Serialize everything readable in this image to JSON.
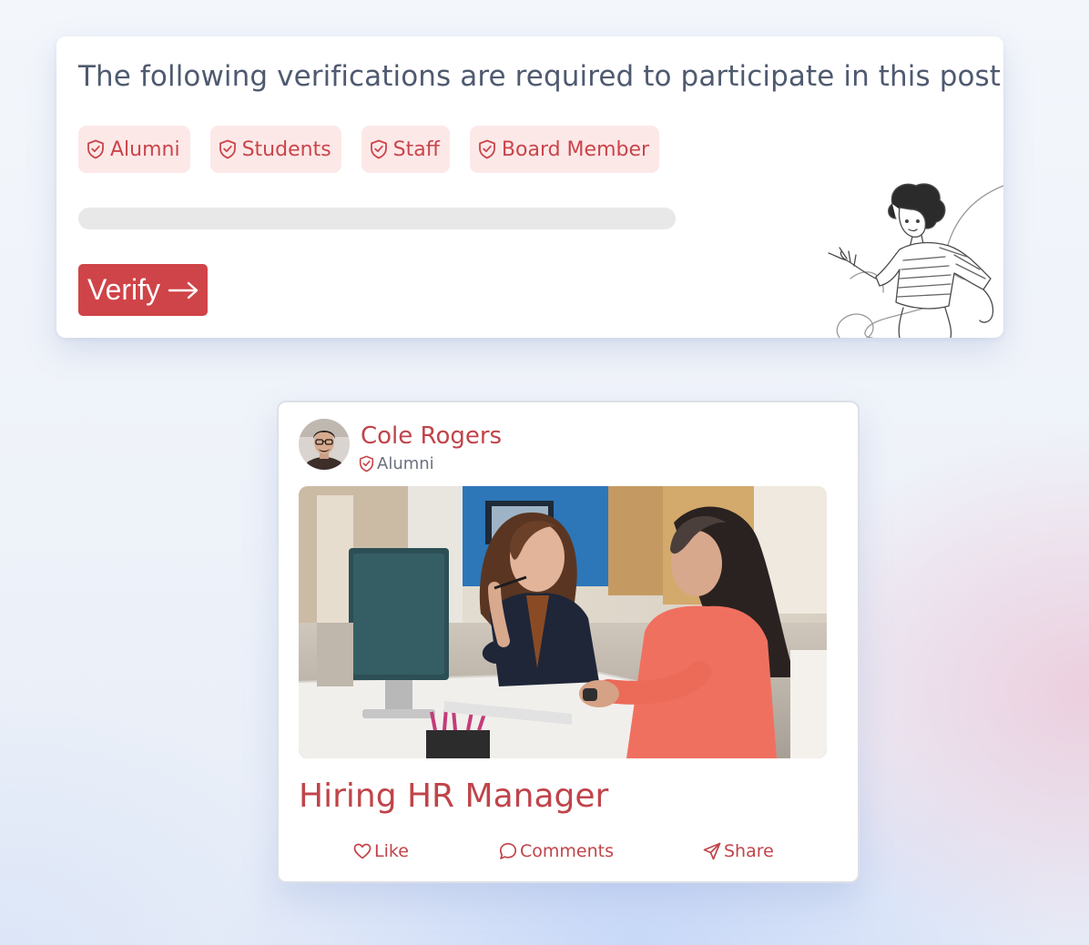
{
  "verification": {
    "title": "The following verifications are required to participate in this post",
    "tags": [
      {
        "label": "Alumni",
        "icon": "shield-check-icon"
      },
      {
        "label": "Students",
        "icon": "shield-check-icon"
      },
      {
        "label": "Staff",
        "icon": "shield-check-icon"
      },
      {
        "label": "Board Member",
        "icon": "shield-check-icon"
      }
    ],
    "progress": 0,
    "verify_button": {
      "label": "Verify",
      "icon": "arrow-right-icon"
    }
  },
  "post": {
    "author": {
      "name": "Cole Rogers",
      "badge": "Alumni",
      "badge_icon": "shield-check-icon"
    },
    "title": "Hiring HR Manager",
    "actions": {
      "like": {
        "label": "Like",
        "icon": "heart-icon"
      },
      "comments": {
        "label": "Comments",
        "icon": "speech-bubble-icon"
      },
      "share": {
        "label": "Share",
        "icon": "paper-plane-icon"
      }
    }
  },
  "colors": {
    "accent": "#cf4448",
    "accent_text": "#c0444a",
    "tag_background": "#fde8e8",
    "title_text": "#4f5a70",
    "progress_track": "#e8e8e8"
  }
}
